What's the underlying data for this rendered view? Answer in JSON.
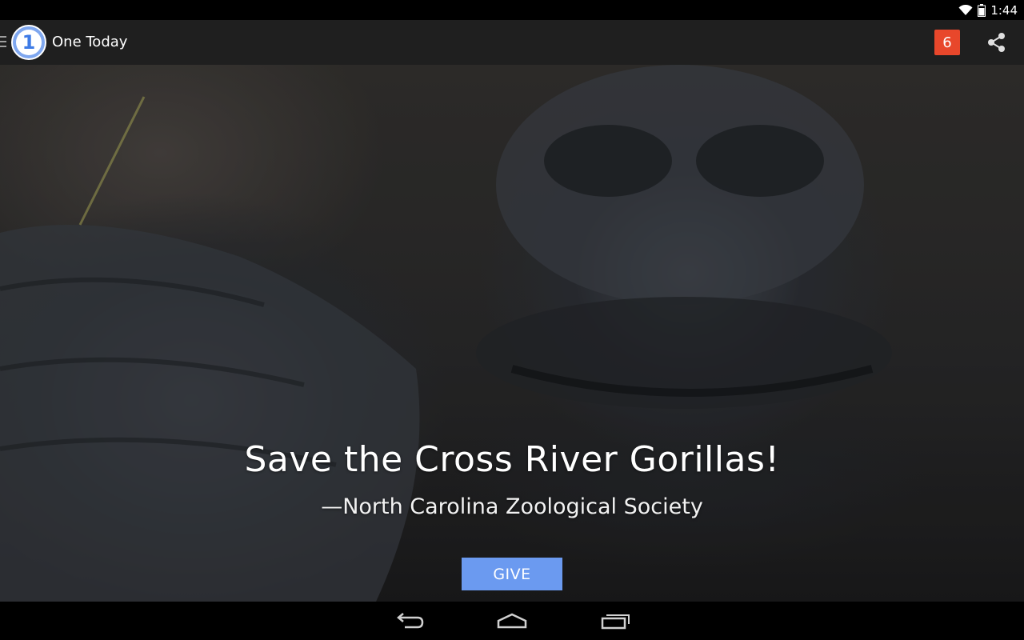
{
  "status_bar": {
    "time": "1:44",
    "icons": [
      "wifi-icon",
      "battery-icon"
    ]
  },
  "action_bar": {
    "icons": [
      "drawer-menu-icon",
      "app-logo-icon",
      "share-icon"
    ],
    "logo_glyph": "1",
    "title": "One Today",
    "notification_count": "6",
    "colors": {
      "background": "#1f1f1f",
      "badge": "#e8472b",
      "logo": "#7fa7ef"
    }
  },
  "hero": {
    "headline": "Save the Cross River Gorillas!",
    "organization": "—North Carolina Zoological Society",
    "give_label": "GIVE",
    "colors": {
      "give_button": "#6b9af0"
    }
  },
  "nav_bar": {
    "icons": [
      "back-icon",
      "home-icon",
      "recent-apps-icon"
    ]
  }
}
